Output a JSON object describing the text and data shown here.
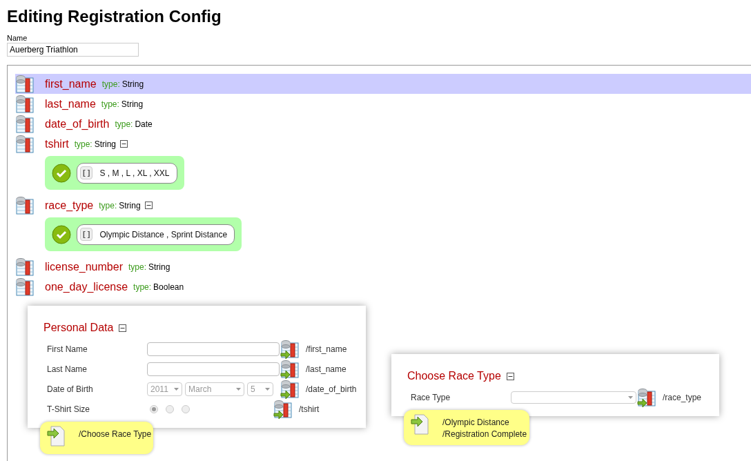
{
  "title": "Editing Registration Config",
  "name_field": {
    "label": "Name",
    "value": "Auerberg Triathlon"
  },
  "fields": [
    {
      "name": "first_name",
      "type_label": "type:",
      "type": "String",
      "selected": true
    },
    {
      "name": "last_name",
      "type_label": "type:",
      "type": "String",
      "selected": false
    },
    {
      "name": "date_of_birth",
      "type_label": "type:",
      "type": "Date",
      "selected": false
    },
    {
      "name": "tshirt",
      "type_label": "type:",
      "type": "String",
      "selected": false,
      "constraint": {
        "bracket": "[ ]",
        "values": "S , M , L , XL , XXL"
      }
    },
    {
      "name": "race_type",
      "type_label": "type:",
      "type": "String",
      "selected": false,
      "constraint": {
        "bracket": "[ ]",
        "values": "Olympic Distance , Sprint Distance"
      }
    },
    {
      "name": "license_number",
      "type_label": "type:",
      "type": "String",
      "selected": false
    },
    {
      "name": "one_day_license",
      "type_label": "type:",
      "type": "Boolean",
      "selected": false
    }
  ],
  "forms": [
    {
      "title": "Personal Data",
      "rows": [
        {
          "kind": "text",
          "label": "First Name",
          "binding": "/first_name"
        },
        {
          "kind": "text",
          "label": "Last Name",
          "binding": "/last_name"
        },
        {
          "kind": "date",
          "label": "Date of Birth",
          "year": "2011",
          "month": "March",
          "day": "5",
          "binding": "/date_of_birth"
        },
        {
          "kind": "radio",
          "label": "T-Shirt Size",
          "options": [
            {
              "selected": true
            },
            {
              "selected": false
            },
            {
              "selected": false
            }
          ],
          "binding": "/tshirt"
        }
      ],
      "transitions": [
        "/Choose Race Type"
      ]
    },
    {
      "title": "Choose Race Type",
      "rows": [
        {
          "kind": "select",
          "label": "Race Type",
          "binding": "/race_type"
        }
      ],
      "transitions": [
        "/Olympic Distance",
        "/Registration Complete"
      ]
    }
  ]
}
